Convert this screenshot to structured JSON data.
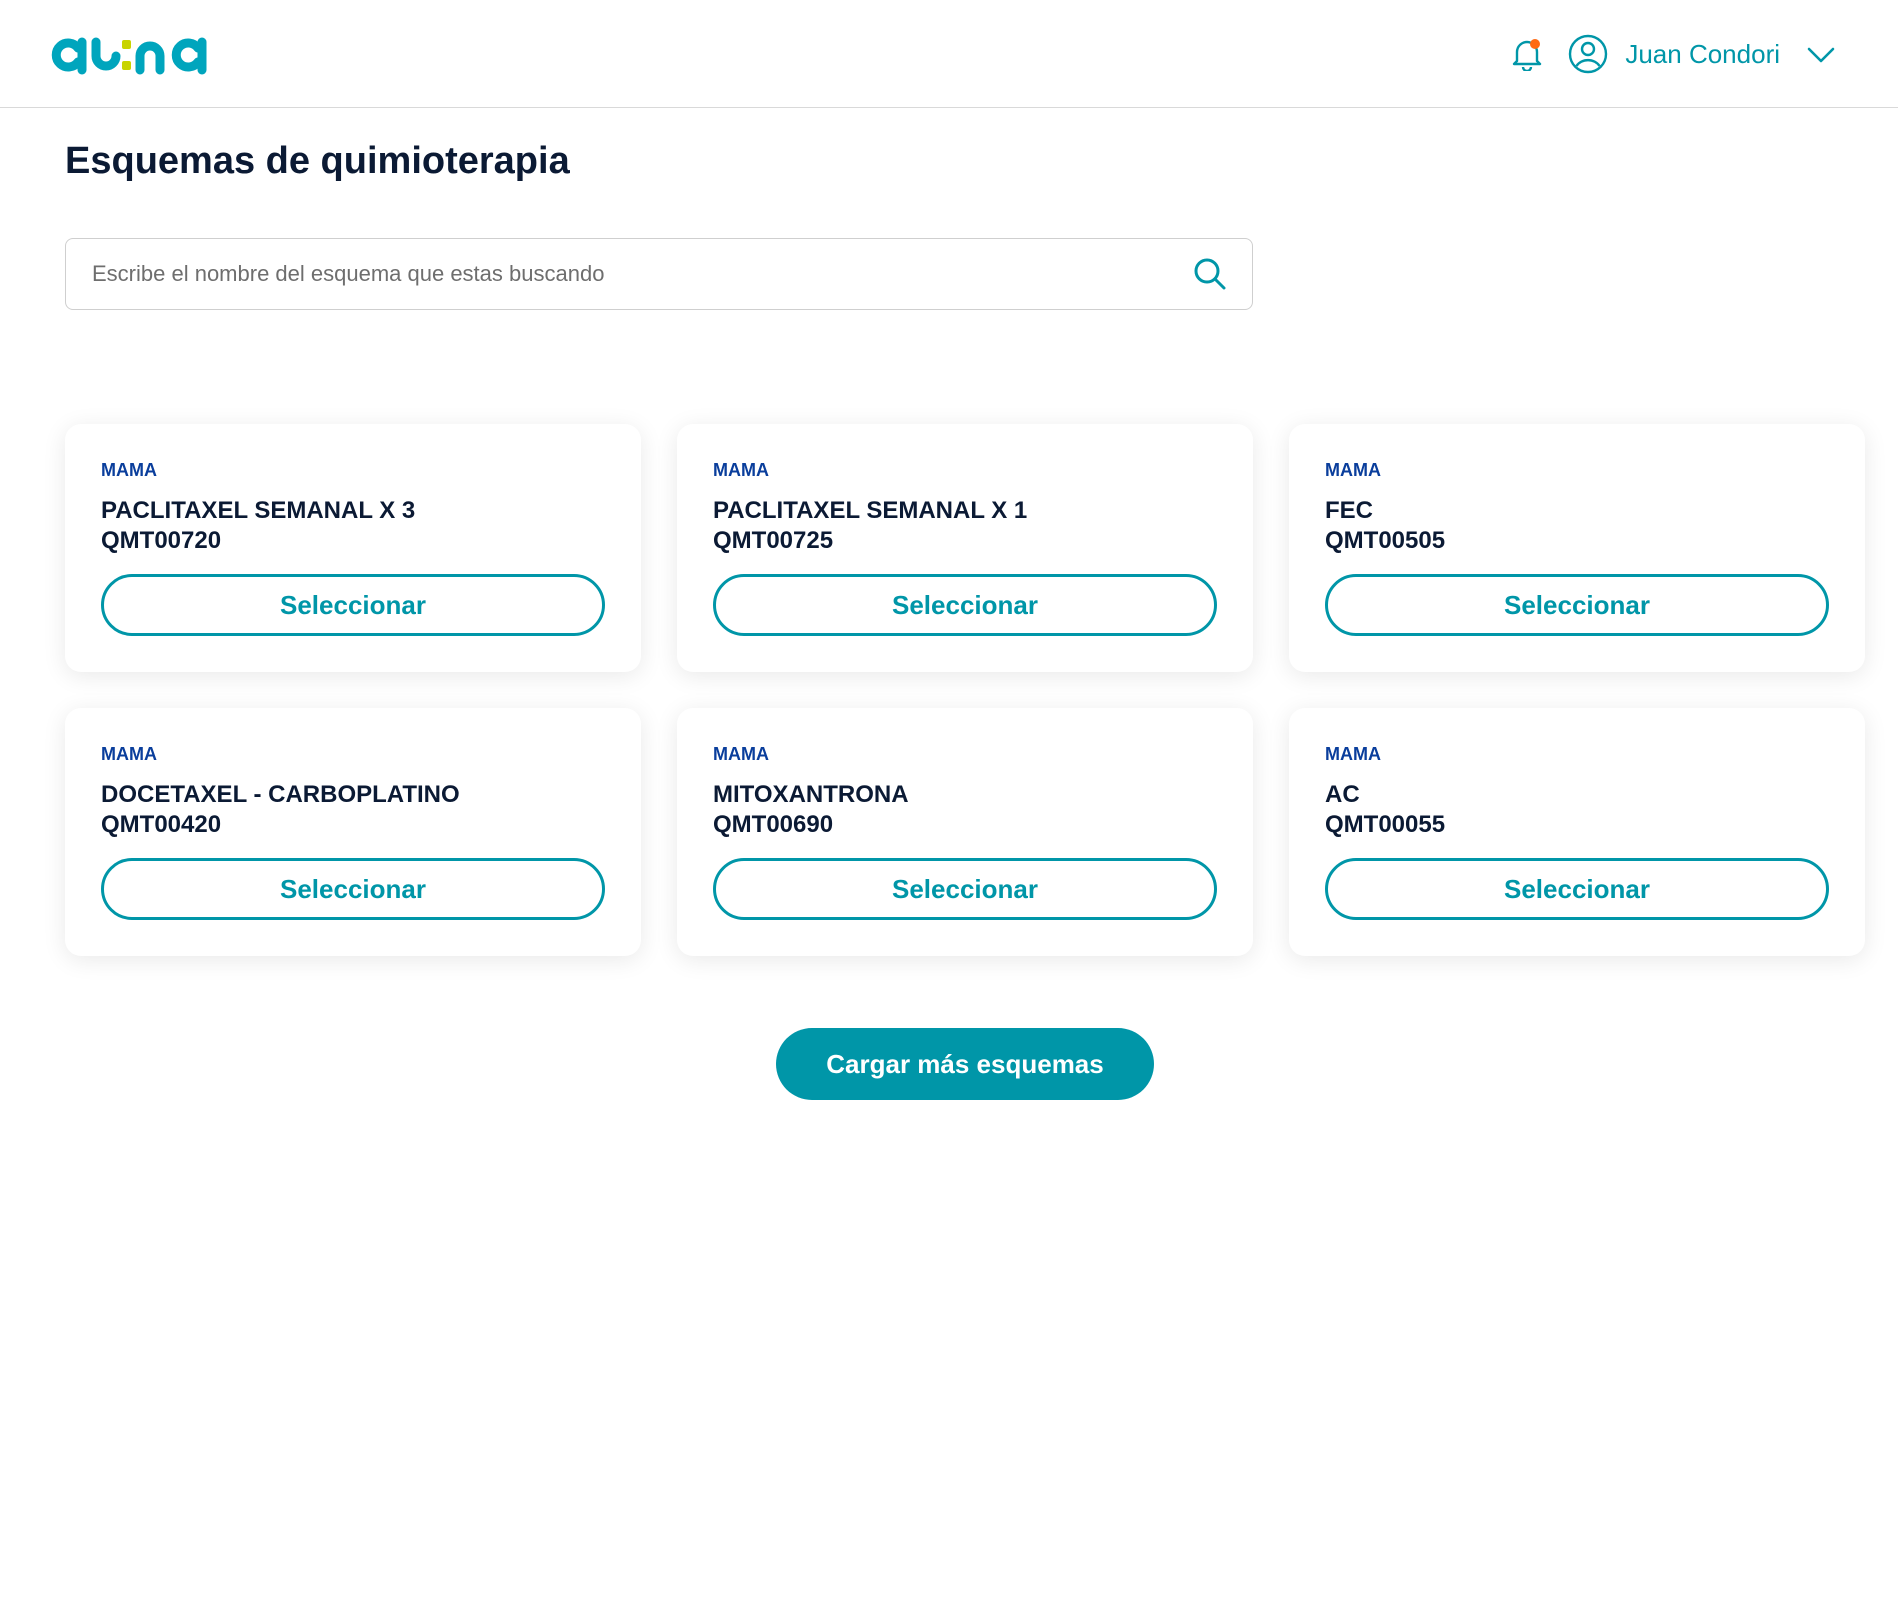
{
  "header": {
    "logo_text": "auna",
    "user_name": "Juan Condori",
    "notification_dot_color": "#ff6a13",
    "accent_color": "#0096a8"
  },
  "page": {
    "title": "Esquemas de quimioterapia"
  },
  "search": {
    "placeholder": "Escribe el nombre del esquema que estas buscando",
    "value": ""
  },
  "cards": [
    {
      "category": "MAMA",
      "name": "PACLITAXEL SEMANAL X 3",
      "code": "QMT00720",
      "button_label": "Seleccionar"
    },
    {
      "category": "MAMA",
      "name": "PACLITAXEL SEMANAL X 1",
      "code": "QMT00725",
      "button_label": "Seleccionar"
    },
    {
      "category": "MAMA",
      "name": "FEC",
      "code": "QMT00505",
      "button_label": "Seleccionar"
    },
    {
      "category": "MAMA",
      "name": "DOCETAXEL - CARBOPLATINO",
      "code": "QMT00420",
      "button_label": "Seleccionar"
    },
    {
      "category": "MAMA",
      "name": "MITOXANTRONA",
      "code": "QMT00690",
      "button_label": "Seleccionar"
    },
    {
      "category": "MAMA",
      "name": "AC",
      "code": "QMT00055",
      "button_label": "Seleccionar"
    }
  ],
  "load_more": {
    "label": "Cargar más esquemas"
  }
}
